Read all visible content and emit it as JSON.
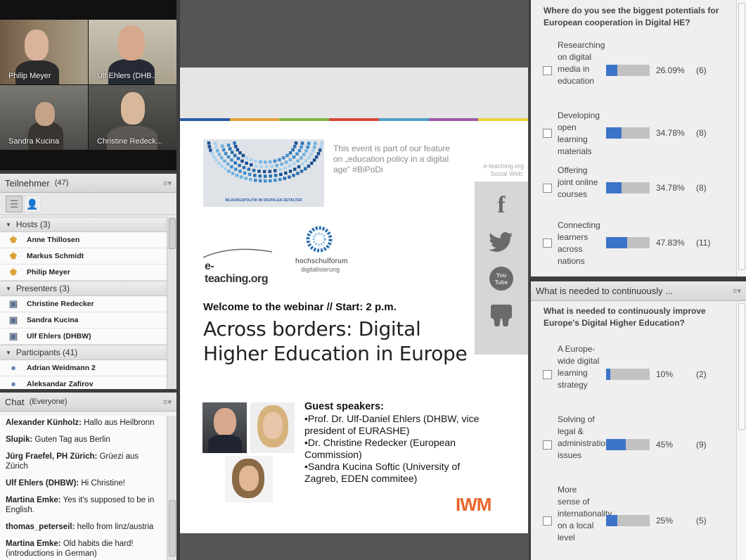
{
  "video": {
    "participants": [
      {
        "name": "Philip Meyer"
      },
      {
        "name": "Ulf Ehlers (DHB..."
      },
      {
        "name": "Sandra Kucina"
      },
      {
        "name": "Christine Redeck..."
      }
    ]
  },
  "attendees": {
    "title": "Teilnehmer",
    "count": "(47)",
    "groups": [
      {
        "label": "Hosts (3)",
        "people": [
          "Anne Thillosen",
          "Markus Schmidt",
          "Philip Meyer"
        ]
      },
      {
        "label": "Presenters (3)",
        "people": [
          "Christine Redecker",
          "Sandra Kucina",
          "Ulf Ehlers (DHBW)"
        ]
      },
      {
        "label": "Participants (41)",
        "people": [
          "Adrian Weidmann 2",
          "Aleksandar Zafirov"
        ]
      }
    ]
  },
  "chat": {
    "title": "Chat",
    "scope": "(Everyone)",
    "messages": [
      {
        "sender": "Alexander Künholz:",
        "text": "Hallo aus Heilbronn"
      },
      {
        "sender": "Slupik:",
        "text": "Guten Tag aus Berlin"
      },
      {
        "sender": "Jürg Fraefel, PH Zürich:",
        "text": "Grüezi aus Zürich"
      },
      {
        "sender": "Ulf Ehlers (DHBW):",
        "text": "Hi Christine!"
      },
      {
        "sender": "Martina Emke:",
        "text": "Yes it's supposed to be in English."
      },
      {
        "sender": "thomas_peterseil:",
        "text": "hello from linz/austria"
      },
      {
        "sender": "Martina Emke:",
        "text": "Old habits die hard! (introductions in German)"
      }
    ]
  },
  "slide": {
    "logo_caption": "BILDUNGSPOLITIK IM DIGITALEN ZEITALTER",
    "event_note": "This event is part of our feature on „education policy in a digital age“ #BiPoDi",
    "social_label": "e-teaching.org Social Web:",
    "eteaching": "e-teaching.org",
    "hsf_name": "hochschulforum",
    "hsf_sub": "digitalisierung",
    "welcome": "Welcome to the webinar // Start: 2 p.m.",
    "title": "Across borders: Digital Higher Education in Europe",
    "guest_heading": "Guest speakers:",
    "guests": [
      "•Prof. Dr. Ulf-Daniel Ehlers (DHBW, vice president of EURASHE)",
      "•Dr. Christine Redecker (European Commission)",
      "•Sandra Kucina Softic (University of Zagreb, EDEN commitee)"
    ],
    "iwm": "IWM",
    "strip_colors": [
      "#2a5ba8",
      "#e8a23a",
      "#7fb543",
      "#d6473a",
      "#4aa0c8",
      "#9b59a6",
      "#e8d23a"
    ]
  },
  "poll1": {
    "question": "Where do you see the biggest potentials for European cooperation in Digital HE?",
    "options": [
      {
        "label": "Researching on digital media in education",
        "pct": "26.09%",
        "count": "(6)",
        "value": 0.2609
      },
      {
        "label": "Developing open learning materials",
        "pct": "34.78%",
        "count": "(8)",
        "value": 0.3478
      },
      {
        "label": "Offering joint online courses",
        "pct": "34.78%",
        "count": "(8)",
        "value": 0.3478
      },
      {
        "label": "Connecting learners across nations",
        "pct": "47.83%",
        "count": "(11)",
        "value": 0.4783
      }
    ]
  },
  "poll2": {
    "pod_title": "What is needed to continuously ...",
    "question": "What is needed to continuously improve Europe's Digital Higher Education?",
    "options": [
      {
        "label": "A Europe-wide digital learning strategy",
        "pct": "10%",
        "count": "(2)",
        "value": 0.1
      },
      {
        "label": "Solving of legal & administrational issues",
        "pct": "45%",
        "count": "(9)",
        "value": 0.45
      },
      {
        "label": "More sense of internationality on a local level",
        "pct": "25%",
        "count": "(5)",
        "value": 0.25
      }
    ]
  }
}
